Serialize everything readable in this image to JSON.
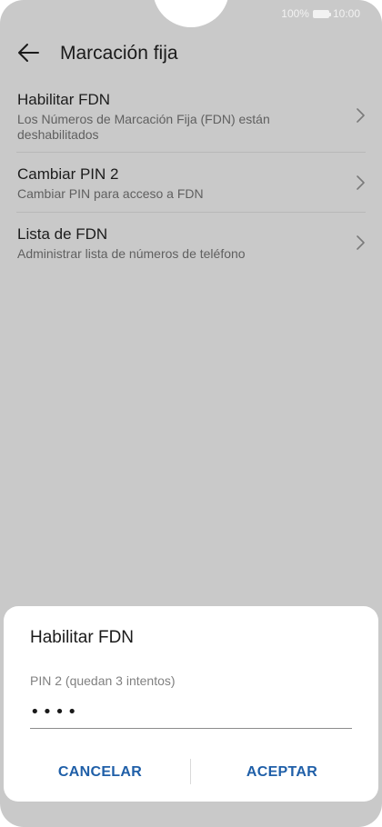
{
  "status_bar": {
    "battery": "100%",
    "time": "10:00"
  },
  "app_bar": {
    "title": "Marcación fija"
  },
  "settings": [
    {
      "title": "Habilitar FDN",
      "subtitle": "Los Números de Marcación Fija (FDN) están deshabilitados"
    },
    {
      "title": "Cambiar PIN 2",
      "subtitle": "Cambiar PIN para acceso a FDN"
    },
    {
      "title": "Lista de FDN",
      "subtitle": "Administrar lista de números de teléfono"
    }
  ],
  "dialog": {
    "title": "Habilitar FDN",
    "pin_label": "PIN 2 (quedan 3 intentos)",
    "pin_value": "••••",
    "cancel_label": "CANCELAR",
    "accept_label": "ACEPTAR"
  },
  "colors": {
    "accent": "#1f5fa8",
    "scrim": "#c9c9c9"
  }
}
